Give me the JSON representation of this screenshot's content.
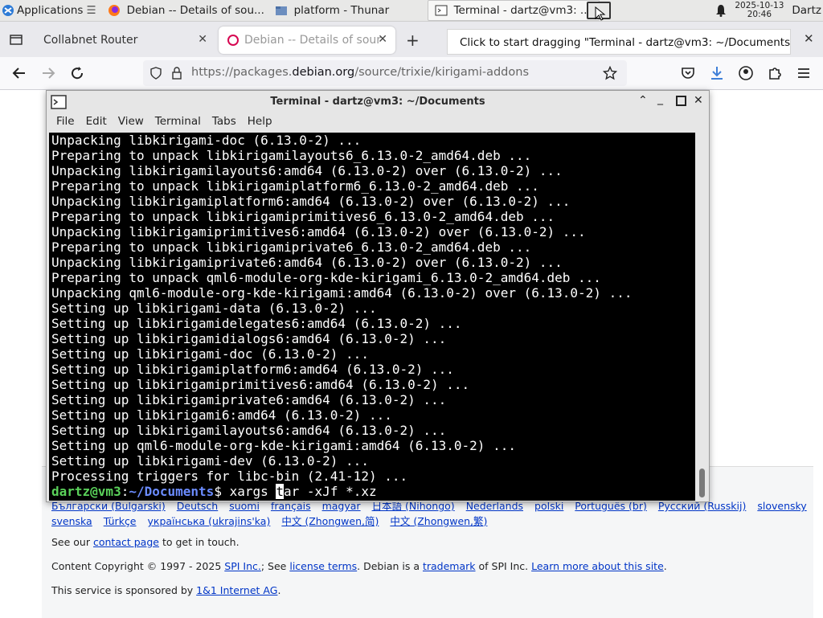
{
  "taskbar": {
    "applications_label": "Applications",
    "tasks": [
      {
        "label": "Debian -- Details of sou...",
        "icon": "firefox-icon"
      },
      {
        "label": "platform - Thunar",
        "icon": "folder-icon"
      },
      {
        "label": "Terminal - dartz@vm3: ...",
        "icon": "terminal-icon"
      }
    ],
    "date": "2025-10-13",
    "time": "20:46",
    "user": "Dartz"
  },
  "browser": {
    "tabs": [
      {
        "label": "Collabnet Router"
      },
      {
        "label": "Debian -- Details of sourc"
      }
    ],
    "tooltip": "Click to start dragging \"Terminal - dartz@vm3: ~/Documents\"",
    "url_prefix": "https://packages.",
    "url_domain": "debian.org",
    "url_suffix": "/source/trixie/kirigami-addons"
  },
  "terminal": {
    "title": "Terminal - dartz@vm3: ~/Documents",
    "menu": [
      "File",
      "Edit",
      "View",
      "Terminal",
      "Tabs",
      "Help"
    ],
    "lines": [
      "Unpacking libkirigami-doc (6.13.0-2) ...",
      "Preparing to unpack libkirigamilayouts6_6.13.0-2_amd64.deb ...",
      "Unpacking libkirigamilayouts6:amd64 (6.13.0-2) over (6.13.0-2) ...",
      "Preparing to unpack libkirigamiplatform6_6.13.0-2_amd64.deb ...",
      "Unpacking libkirigamiplatform6:amd64 (6.13.0-2) over (6.13.0-2) ...",
      "Preparing to unpack libkirigamiprimitives6_6.13.0-2_amd64.deb ...",
      "Unpacking libkirigamiprimitives6:amd64 (6.13.0-2) over (6.13.0-2) ...",
      "Preparing to unpack libkirigamiprivate6_6.13.0-2_amd64.deb ...",
      "Unpacking libkirigamiprivate6:amd64 (6.13.0-2) over (6.13.0-2) ...",
      "Preparing to unpack qml6-module-org-kde-kirigami_6.13.0-2_amd64.deb ...",
      "Unpacking qml6-module-org-kde-kirigami:amd64 (6.13.0-2) over (6.13.0-2) ...",
      "Setting up libkirigami-data (6.13.0-2) ...",
      "Setting up libkirigamidelegates6:amd64 (6.13.0-2) ...",
      "Setting up libkirigamidialogs6:amd64 (6.13.0-2) ...",
      "Setting up libkirigami-doc (6.13.0-2) ...",
      "Setting up libkirigamiplatform6:amd64 (6.13.0-2) ...",
      "Setting up libkirigamiprimitives6:amd64 (6.13.0-2) ...",
      "Setting up libkirigamiprivate6:amd64 (6.13.0-2) ...",
      "Setting up libkirigami6:amd64 (6.13.0-2) ...",
      "Setting up libkirigamilayouts6:amd64 (6.13.0-2) ...",
      "Setting up qml6-module-org-kde-kirigami:amd64 (6.13.0-2) ...",
      "Setting up libkirigami-dev (6.13.0-2) ...",
      "Processing triggers for libc-bin (2.41-12) ..."
    ],
    "prompt_user": "dartz@vm3",
    "prompt_sep": ":",
    "prompt_path": "~/Documents",
    "prompt_symbol": "$ ",
    "command_before_cursor": "xargs ",
    "command_cursor_char": "t",
    "command_after_cursor": "ar -xJf *.xz"
  },
  "page": {
    "languages_row1": [
      "Български (Bulgarski)",
      "Deutsch",
      "suomi",
      "français",
      "magyar",
      "日本語 (Nihongo)",
      "Nederlands",
      "polski",
      "Português (br)",
      "Русский (Russkij)",
      "slovensky"
    ],
    "languages_row2": [
      "svenska",
      "Türkçe",
      "українська (ukrajins'ka)",
      "中文 (Zhongwen,简)",
      "中文 (Zhongwen,繁)"
    ],
    "contact_before": "See our ",
    "contact_link": "contact page",
    "contact_after": " to get in touch.",
    "copyright_text": "Content Copyright © 1997 - 2025 ",
    "spi_link": "SPI Inc.",
    "see_text": "; See ",
    "license_link": "license terms",
    "debian_is": ". Debian is a ",
    "trademark_link": "trademark",
    "of_spi": " of SPI Inc. ",
    "learn_link": "Learn more about this site",
    "period": ".",
    "sponsor_text": "This service is sponsored by ",
    "sponsor_link": "1&1 Internet AG",
    "sponsor_end": "."
  },
  "colors": {
    "prompt_user": "#5ad15a",
    "prompt_path": "#6b8cff",
    "link": "#0035c7"
  }
}
